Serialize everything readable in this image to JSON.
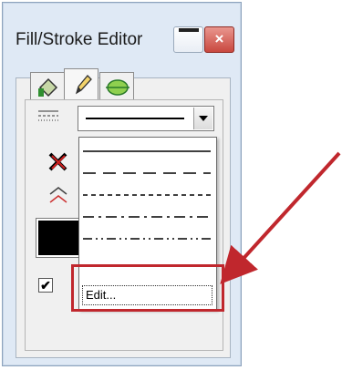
{
  "window": {
    "title": "Fill/Stroke Editor",
    "close_glyph": "×"
  },
  "tabs": [
    {
      "name": "fill-tab",
      "icon": "paint-bucket-icon"
    },
    {
      "name": "stroke-tab",
      "icon": "pencil-icon",
      "active": true
    },
    {
      "name": "shape-tab",
      "icon": "ellipse-icon"
    }
  ],
  "line_style_dropdown": {
    "selected": "solid",
    "options": [
      "solid",
      "long-dash",
      "short-dash",
      "dash-dot",
      "dash-dot-dot"
    ],
    "edit_label": "Edit..."
  },
  "checkbox": {
    "checked": true,
    "glyph": "✔"
  },
  "swatch": {
    "color": "#000000"
  },
  "colors": {
    "callout": "#c0272d"
  }
}
